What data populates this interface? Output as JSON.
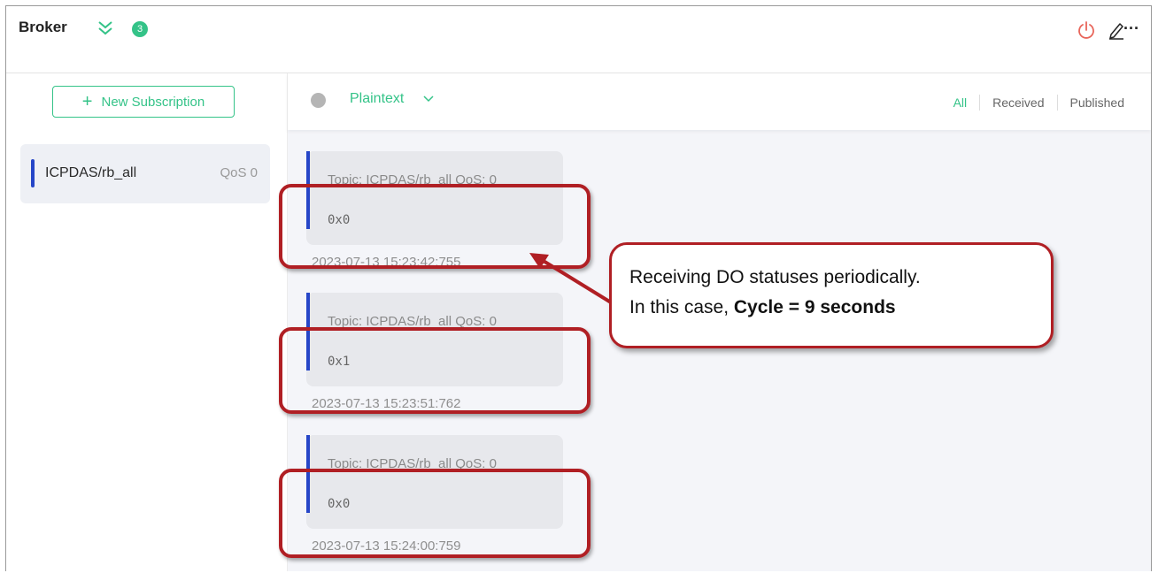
{
  "header": {
    "title": "Broker",
    "connection_count": "3",
    "icons": [
      "double-chevron-icon",
      "power-icon",
      "edit-icon",
      "more-icon"
    ]
  },
  "subscriptions": {
    "new_label": "New Subscription",
    "items": [
      {
        "topic": "ICPDAS/rb_all",
        "qos": "QoS 0"
      }
    ]
  },
  "toolbar": {
    "format": "Plaintext",
    "filters": [
      "All",
      "Received",
      "Published"
    ],
    "active_filter": "All"
  },
  "messages": [
    {
      "meta": "Topic: ICPDAS/rb_all   QoS: 0",
      "payload": "0x0",
      "time": "2023-07-13 15:23:42:755"
    },
    {
      "meta": "Topic: ICPDAS/rb_all   QoS: 0",
      "payload": "0x1",
      "time": "2023-07-13 15:23:51:762"
    },
    {
      "meta": "Topic: ICPDAS/rb_all   QoS: 0",
      "payload": "0x0",
      "time": "2023-07-13 15:24:00:759"
    }
  ],
  "annotation": {
    "line1": "Receiving DO statuses periodically.",
    "line2_prefix": "In this case, ",
    "line2_bold": "Cycle = 9 seconds"
  },
  "colors": {
    "accent": "#34c388",
    "topic_bar": "#2646c8",
    "highlight": "#b01f24"
  }
}
